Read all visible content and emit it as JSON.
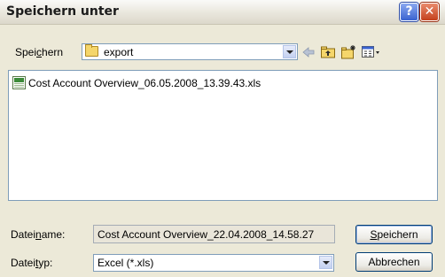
{
  "window": {
    "title": "Speichern unter",
    "help_label": "?",
    "close_label": "✕"
  },
  "savein": {
    "label_pre": "Spei",
    "label_acc": "c",
    "label_post": "hern",
    "value": "export"
  },
  "toolbar": {
    "back_icon": "back-arrow-icon",
    "up_icon": "folder-up-icon",
    "new_folder_icon": "new-folder-icon",
    "views_icon": "views-menu-icon"
  },
  "files": [
    {
      "name": "Cost Account Overview_06.05.2008_13.39.43.xls",
      "icon": "excel-file-icon"
    }
  ],
  "filename": {
    "label_pre": "Datei",
    "label_acc": "n",
    "label_post": "ame:",
    "value": "Cost Account Overview_22.04.2008_14.58.27"
  },
  "filetype": {
    "label_pre": "Datei",
    "label_acc": "t",
    "label_post": "yp:",
    "value": "Excel (*.xls)"
  },
  "buttons": {
    "save_acc": "S",
    "save_rest": "peichern",
    "cancel": "Abbrechen"
  },
  "colors": {
    "dialog_bg": "#ece9d8",
    "border_blue": "#7f9db9",
    "close_red": "#c4411d",
    "help_blue": "#3a63d0"
  }
}
